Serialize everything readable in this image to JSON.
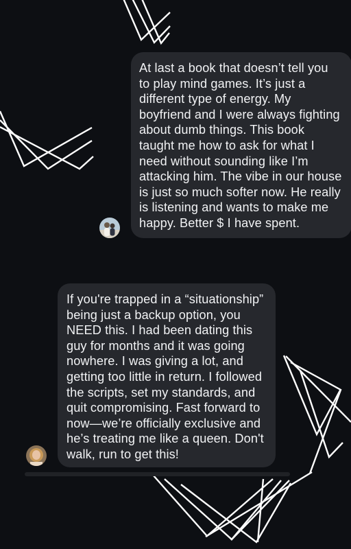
{
  "comments": [
    {
      "avatar_icon": "user-photo-avatar-couple",
      "text": "At last a book that doesn’t tell you\nto play mind games. It’s just a\ndifferent type of energy. My\nboyfriend and I were always fighting\nabout dumb things. This book\ntaught me how to ask for what I\nneed without sounding like I’m\nattacking him. The vibe in our house\nis just so much softer now. He really\nis listening and wants to make me\nhappy. Better $ I have spent."
    },
    {
      "avatar_icon": "user-photo-avatar-woman",
      "text": "If you're trapped in a “situationship”\nbeing just a backup option, you\nNEED this. I had been dating this\nguy for months and it was going\nnowhere. I was giving a lot, and\ngetting too little in return. I followed\nthe scripts, set my standards, and\nquit compromising. Fast forward to\nnow—we’re officially exclusive and\nhe’s treating me like a queen. Don't\nwalk, run to get this!"
    }
  ],
  "colors": {
    "background": "#0d0f13",
    "bubble": "#26282d",
    "text": "#f1f2f4",
    "decoration": "#ffffff"
  }
}
